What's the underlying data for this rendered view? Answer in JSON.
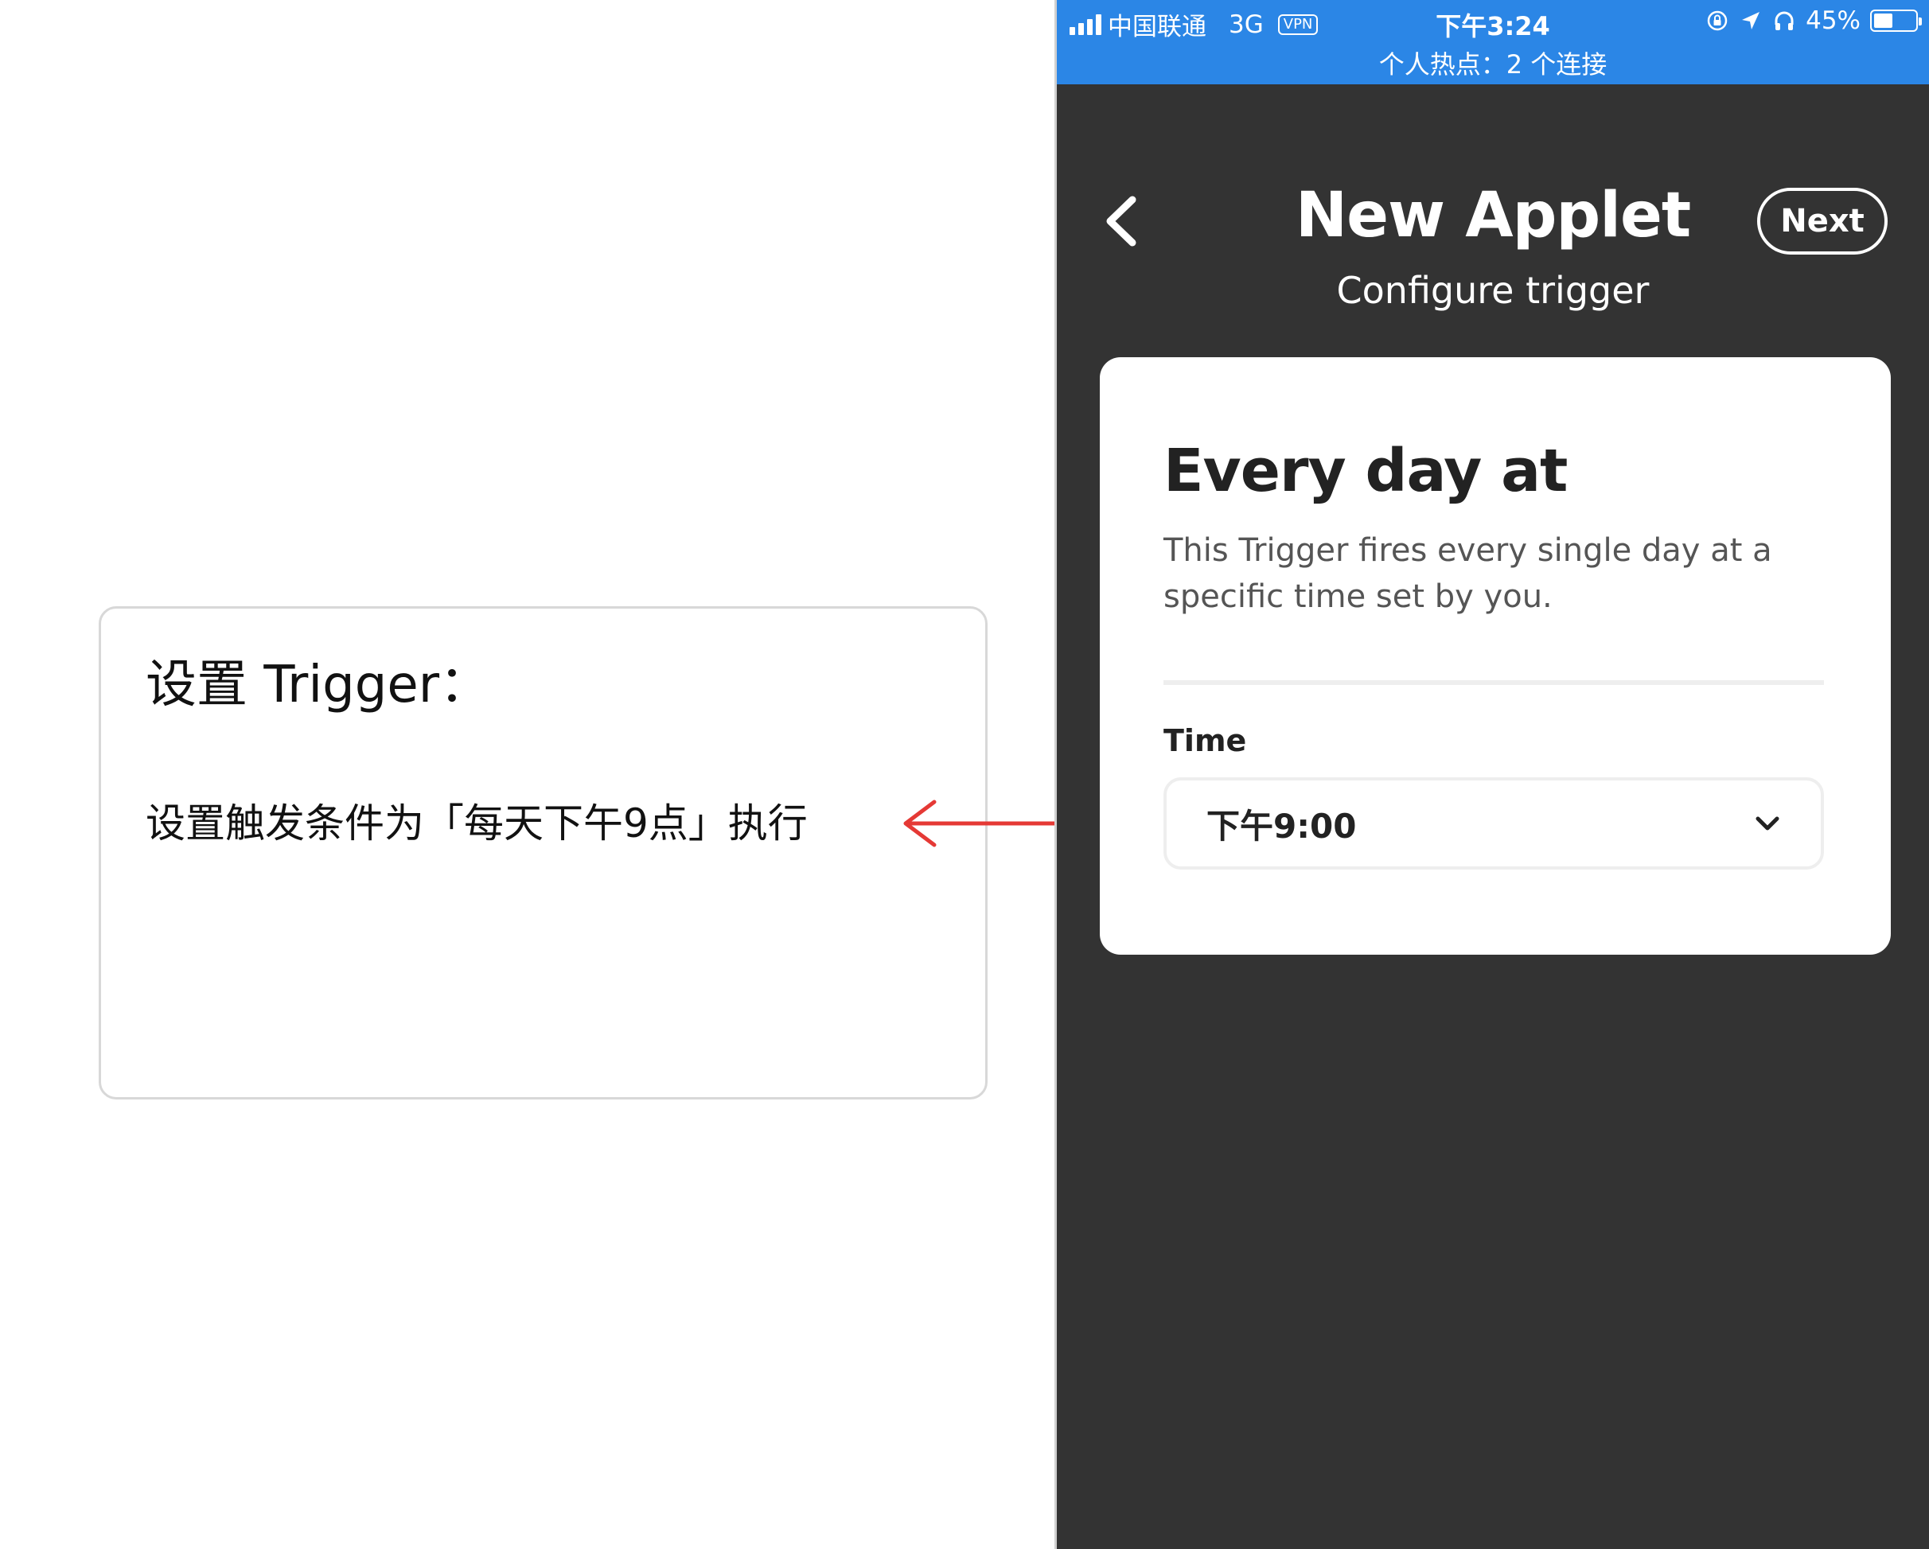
{
  "annotation": {
    "title": "设置 Trigger：",
    "body": "设置触发条件为「每天下午9点」执行"
  },
  "status_bar": {
    "carrier": "中国联通",
    "network": "3G",
    "vpn": "VPN",
    "time": "下午3:24",
    "battery": "45%",
    "battery_level": 0.45,
    "hotspot": "个人热点：2 个连接"
  },
  "nav": {
    "title": "New Applet",
    "subtitle": "Configure trigger",
    "next_label": "Next"
  },
  "card": {
    "title": "Every day at",
    "description": "This Trigger fires every single day at a specific time set by you.",
    "time_label": "Time",
    "time_value": "下午9:00"
  },
  "colors": {
    "status_bar": "#2b86e6",
    "background": "#333333",
    "card": "#ffffff",
    "arrow": "#e53935"
  },
  "icons": {
    "back": "chevron-left-icon",
    "dropdown": "chevron-down-icon",
    "lock": "rotation-lock-icon",
    "location": "location-arrow-icon",
    "headphones": "headphones-icon",
    "battery": "battery-icon",
    "signal": "signal-bars-icon"
  }
}
